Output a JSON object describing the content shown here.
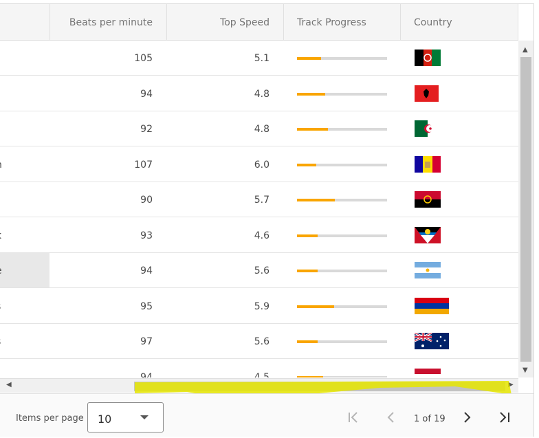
{
  "columns": {
    "bpm": "Beats per minute",
    "speed": "Top Speed",
    "track": "Track Progress",
    "country": "Country"
  },
  "rows": [
    {
      "name": "",
      "bpm": "105",
      "speed": "5.1",
      "progress": 0.27,
      "flag": "af"
    },
    {
      "name": "r",
      "bpm": "94",
      "speed": "4.8",
      "progress": 0.31,
      "flag": "al"
    },
    {
      "name": "",
      "bpm": "92",
      "speed": "4.8",
      "progress": 0.34,
      "flag": "dz"
    },
    {
      "name": "n",
      "bpm": "107",
      "speed": "6.0",
      "progress": 0.21,
      "flag": "ad"
    },
    {
      "name": "",
      "bpm": "90",
      "speed": "5.7",
      "progress": 0.42,
      "flag": "ao"
    },
    {
      "name": "k",
      "bpm": "93",
      "speed": "4.6",
      "progress": 0.23,
      "flag": "ag"
    },
    {
      "name": "e",
      "bpm": "94",
      "speed": "5.6",
      "progress": 0.23,
      "flag": "ar",
      "selected": true
    },
    {
      "name": "s",
      "bpm": "95",
      "speed": "5.9",
      "progress": 0.41,
      "flag": "am"
    },
    {
      "name": "s",
      "bpm": "97",
      "speed": "5.6",
      "progress": 0.23,
      "flag": "au"
    },
    {
      "name": "",
      "bpm": "94",
      "speed": "4.5",
      "progress": 0.29,
      "flag": "at"
    }
  ],
  "footer": {
    "items_per_page_label": "Items per page",
    "page_size": "10",
    "page_info": "1 of 19"
  },
  "colors": {
    "accent": "#f9a500",
    "highlight": "#e6e600"
  },
  "icons": {
    "first": "first-page-icon",
    "prev": "chevron-left-icon",
    "next": "chevron-right-icon",
    "last": "last-page-icon",
    "dropdown": "caret-down-icon"
  }
}
